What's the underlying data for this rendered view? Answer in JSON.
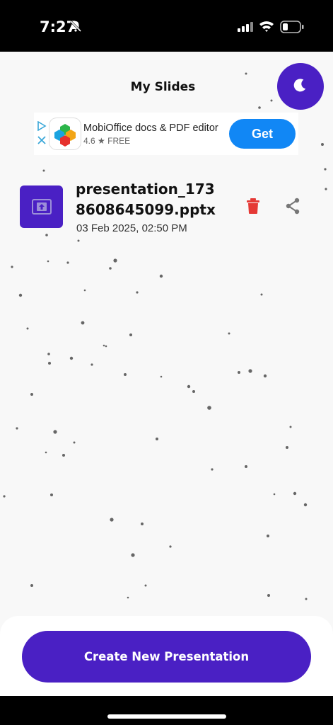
{
  "status_bar": {
    "time": "7:27",
    "icons": [
      "bell-slash-icon",
      "cellular-signal-icon",
      "wifi-icon",
      "battery-icon"
    ]
  },
  "header": {
    "title": "My Slides",
    "theme_toggle_icon": "moon-icon"
  },
  "ad": {
    "app_name": "MobiOffice docs & PDF editor",
    "rating_text": "4.6 ★ FREE",
    "cta_label": "Get",
    "icons": [
      "ad-choices-icon",
      "ad-close-icon",
      "mobioffice-app-icon"
    ]
  },
  "files": [
    {
      "name": "presentation_1738608645099.pptx",
      "date": "03 Feb 2025, 02:50 PM",
      "icons": [
        "presentation-file-icon",
        "trash-icon",
        "share-icon"
      ]
    }
  ],
  "footer": {
    "create_label": "Create New Presentation"
  },
  "colors": {
    "accent": "#4a20c4",
    "delete": "#e53935",
    "ad_cta": "#1187f5",
    "background": "#f8f8f8"
  }
}
